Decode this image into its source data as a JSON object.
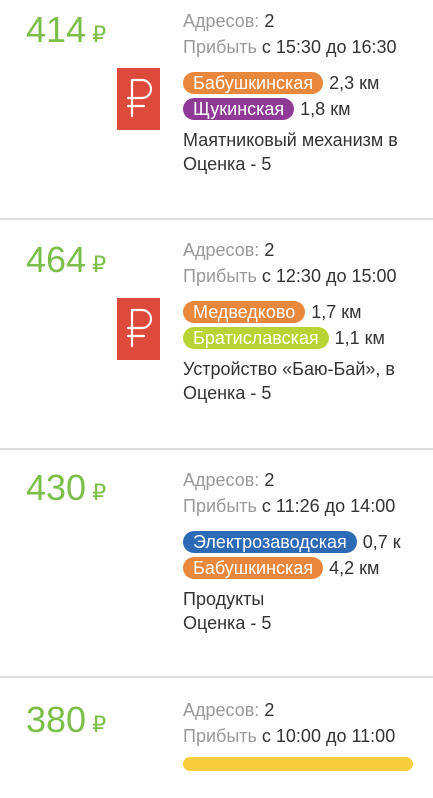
{
  "currency_symbol": "₽",
  "labels": {
    "addresses": "Адресов:",
    "arrive": "Прибыть",
    "from": "с",
    "to": "до"
  },
  "orders": [
    {
      "price": "414",
      "addresses": "2",
      "time_from": "15:30",
      "time_to": "16:30",
      "metro": [
        {
          "name": "Бабушкинская",
          "distance": "2,3 км",
          "color": "#e9883d"
        },
        {
          "name": "Щукинская",
          "distance": "1,8 км",
          "color": "#8e3a96"
        }
      ],
      "description": "Маятниковый механизм в",
      "rating": "Оценка - 5"
    },
    {
      "price": "464",
      "addresses": "2",
      "time_from": "12:30",
      "time_to": "15:00",
      "metro": [
        {
          "name": "Медведково",
          "distance": "1,7 км",
          "color": "#e9883d"
        },
        {
          "name": "Братиславская",
          "distance": "1,1 км",
          "color": "#b8d434"
        }
      ],
      "description": "Устройство «Баю-Бай»,  в",
      "rating": "Оценка - 5"
    },
    {
      "price": "430",
      "addresses": "2",
      "time_from": "11:26",
      "time_to": "14:00",
      "metro": [
        {
          "name": "Электрозаводская",
          "distance": "0,7 к",
          "color": "#2c6ab5"
        },
        {
          "name": "Бабушкинская",
          "distance": "4,2 км",
          "color": "#e9883d"
        }
      ],
      "description": "Продукты",
      "rating": "Оценка - 5"
    },
    {
      "price": "380",
      "addresses": "2",
      "time_from": "10:00",
      "time_to": "11:00"
    }
  ]
}
